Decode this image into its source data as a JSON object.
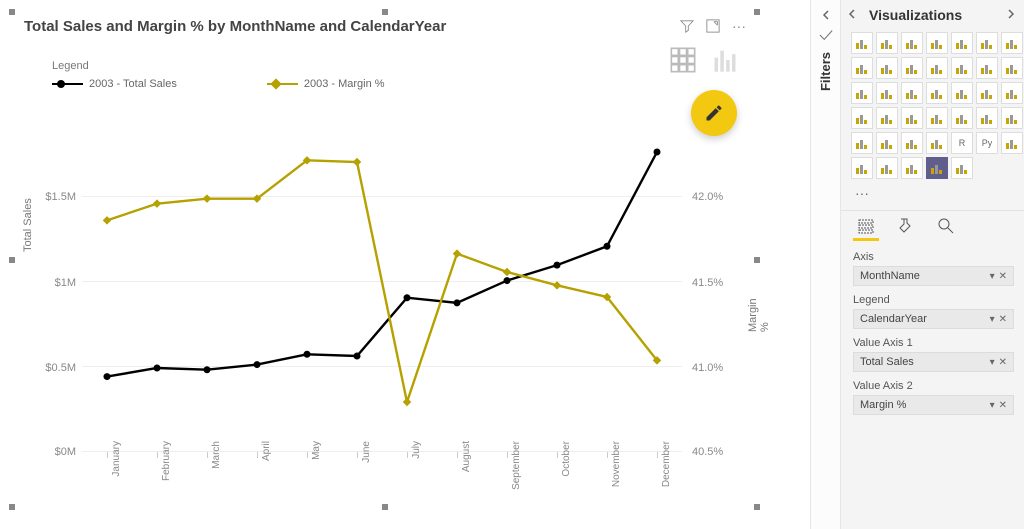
{
  "chart": {
    "title": "Total Sales and Margin % by MonthName and CalendarYear",
    "legend_title": "Legend",
    "series_label_sales": "2003 - Total Sales",
    "series_label_margin": "2003 - Margin %",
    "y_left_label": "Total Sales",
    "y_right_label": "Margin %",
    "y_left_ticks": [
      "$0M",
      "$0.5M",
      "$1M",
      "$1.5M"
    ],
    "y_right_ticks": [
      "40.5%",
      "41.0%",
      "41.5%",
      "42.0%"
    ],
    "colors": {
      "sales": "#000000",
      "margin": "#b5a100"
    }
  },
  "chart_data": {
    "type": "line",
    "categories": [
      "January",
      "February",
      "March",
      "April",
      "May",
      "June",
      "July",
      "August",
      "September",
      "October",
      "November",
      "December"
    ],
    "series": [
      {
        "name": "2003 - Total Sales",
        "axis": "left",
        "values": [
          0.44,
          0.49,
          0.48,
          0.51,
          0.57,
          0.56,
          0.9,
          0.87,
          1.0,
          1.09,
          1.2,
          1.75
        ]
      },
      {
        "name": "2003 - Margin %",
        "axis": "right",
        "values": [
          41.89,
          41.99,
          42.02,
          42.02,
          42.25,
          42.24,
          40.8,
          41.69,
          41.58,
          41.5,
          41.43,
          41.05
        ]
      }
    ],
    "y_left": {
      "label": "Total Sales",
      "range": [
        0,
        1.75
      ],
      "unit": "$M"
    },
    "y_right": {
      "label": "Margin %",
      "range": [
        40.5,
        42.3
      ],
      "unit": "%"
    }
  },
  "filters": {
    "label": "Filters"
  },
  "vizpane": {
    "title": "Visualizations",
    "icons": [
      "stacked-bar",
      "clustered-bar",
      "stacked-col",
      "clustered-col",
      "stacked-area",
      "line-chart",
      "combo-chart",
      "area",
      "ribbon",
      "waterfall",
      "scatter",
      "line-stacked",
      "line-clustered",
      "card",
      "table",
      "funnel",
      "treemap",
      "pie",
      "donut",
      "gauge",
      "filled-map",
      "globe",
      "matrix",
      "slicer",
      "kpi",
      "map",
      "multi-row",
      "table-alt",
      "hist",
      "bullet",
      "table2",
      "table3",
      "r-visual",
      "py-visual",
      "key",
      "decomp",
      "qna",
      "forecast",
      "paginated",
      "arc"
    ],
    "selected_icon": "paginated",
    "tabs": {
      "fields": "fields",
      "format": "format",
      "analytics": "analytics"
    },
    "wells": {
      "axis_label": "Axis",
      "axis_value": "MonthName",
      "legend_label": "Legend",
      "legend_value": "CalendarYear",
      "val1_label": "Value Axis 1",
      "val1_value": "Total Sales",
      "val2_label": "Value Axis 2",
      "val2_value": "Margin %"
    }
  }
}
